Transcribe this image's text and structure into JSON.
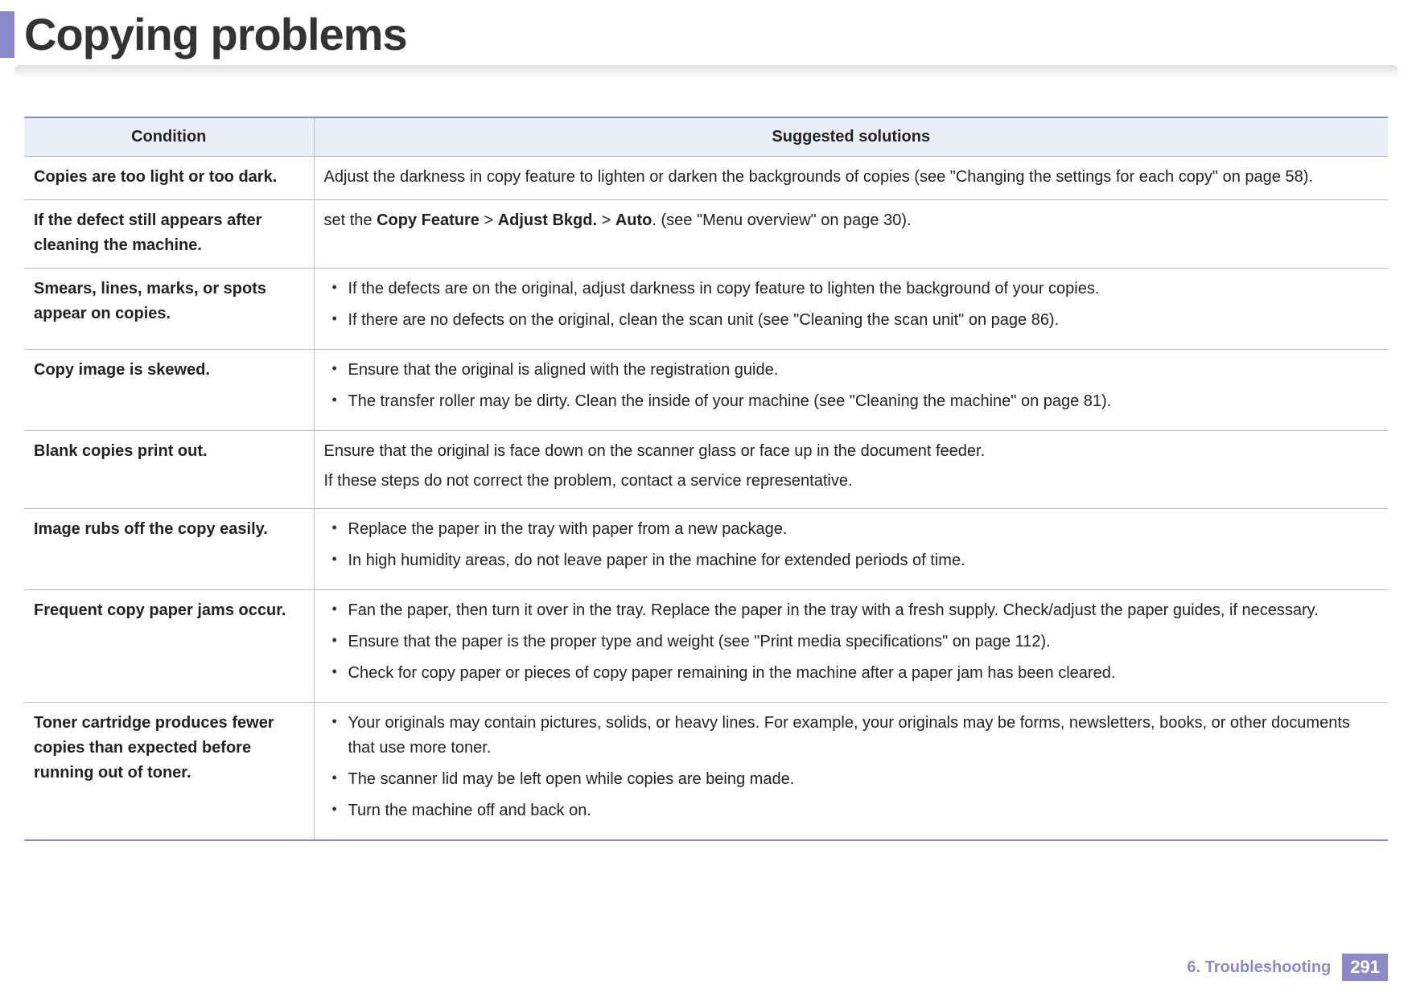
{
  "title": "Copying problems",
  "headers": {
    "condition": "Condition",
    "solutions": "Suggested solutions"
  },
  "rows": [
    {
      "condition": "Copies are too light or too dark.",
      "solution_text": "Adjust the darkness in copy feature to lighten or darken the backgrounds of copies (see \"Changing the settings for each copy\" on page 58)."
    },
    {
      "condition": "If the defect still appears after cleaning the machine.",
      "solution_prefix": "set the ",
      "solution_bold1": "Copy Feature",
      "solution_sep1": " > ",
      "solution_bold2": "Adjust Bkgd.",
      "solution_sep2": " > ",
      "solution_bold3": "Auto",
      "solution_suffix": ". (see \"Menu overview\" on page 30)."
    },
    {
      "condition": "Smears, lines, marks, or spots appear on copies.",
      "solution_items": [
        "If the defects are on the original, adjust darkness in copy feature to lighten the background of your copies.",
        "If there are no defects on the original, clean the scan unit (see \"Cleaning the scan unit\" on page 86)."
      ]
    },
    {
      "condition": "Copy image is skewed.",
      "solution_items": [
        "Ensure that the original is aligned with the registration guide.",
        "The transfer roller may be dirty. Clean the inside of your machine (see \"Cleaning the machine\" on page 81)."
      ]
    },
    {
      "condition": "Blank copies print out.",
      "solution_paras": [
        "Ensure that the original is face down on the scanner glass or face up in the document feeder.",
        "If these steps do not correct the problem, contact a service representative."
      ]
    },
    {
      "condition": "Image rubs off the copy easily.",
      "solution_items": [
        "Replace the paper in the tray with paper from a new package.",
        "In high humidity areas, do not leave paper in the machine for extended periods of time."
      ]
    },
    {
      "condition": "Frequent copy paper jams occur.",
      "solution_items": [
        "Fan the paper, then turn it over in the tray. Replace the paper in the tray with a fresh supply. Check/adjust the paper guides, if necessary.",
        "Ensure that the paper is the proper type and weight (see \"Print media specifications\" on page 112).",
        "Check for copy paper or pieces of copy paper remaining in the machine after a paper jam has been cleared."
      ]
    },
    {
      "condition": "Toner cartridge produces fewer copies than expected before running out of toner.",
      "solution_items": [
        "Your originals may contain pictures, solids, or heavy lines. For example, your originals may be forms, newsletters, books, or other documents that use more toner.",
        "The scanner lid may be left open while copies are being made.",
        "Turn the machine off and back on."
      ]
    }
  ],
  "footer": {
    "chapter": "6.  Troubleshooting",
    "page": "291"
  }
}
